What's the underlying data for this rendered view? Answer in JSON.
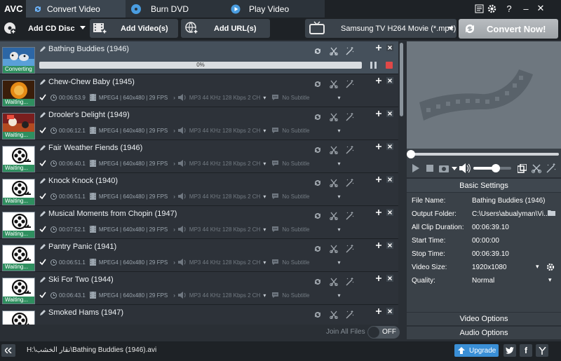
{
  "app": {
    "logo": "AVC"
  },
  "tabs": [
    {
      "label": "Convert Video",
      "active": true
    },
    {
      "label": "Burn DVD",
      "active": false
    },
    {
      "label": "Play Video",
      "active": false
    }
  ],
  "window_controls": {
    "help": "?",
    "minimize": "–",
    "close": "✕"
  },
  "toolbar": {
    "add_cd": "Add CD Disc",
    "add_video": "Add Video(s)",
    "add_url": "Add URL(s)",
    "profile": "Samsung TV H264 Movie (*.mp4)",
    "convert": "Convert Now!"
  },
  "files": [
    {
      "title": "Bathing Buddies (1946)",
      "status": "Converting",
      "thumb": "bath",
      "progress_pct": 0,
      "progress_label": "0%"
    },
    {
      "title": "Chew-Chew Baby (1945)",
      "status": "Waiting...",
      "thumb": "chew",
      "duration": "00:06:53.9",
      "video": "MPEG4 | 640x480 | 29 FPS",
      "audio": "MP3 44 KHz 128 Kbps 2 CH",
      "subtitle": "No Subtitle"
    },
    {
      "title": "Drooler's Delight (1949)",
      "status": "Waiting...",
      "thumb": "drool",
      "duration": "00:06:12.1",
      "video": "MPEG4 | 640x480 | 29 FPS",
      "audio": "MP3 44 KHz 128 Kbps 2 CH",
      "subtitle": "No Subtitle"
    },
    {
      "title": "Fair Weather Fiends (1946)",
      "status": "Waiting...",
      "thumb": "reel",
      "duration": "00:06:40.1",
      "video": "MPEG4 | 640x480 | 29 FPS",
      "audio": "MP3 44 KHz 128 Kbps 2 CH",
      "subtitle": "No Subtitle"
    },
    {
      "title": "Knock Knock (1940)",
      "status": "Waiting...",
      "thumb": "reel",
      "duration": "00:06:51.1",
      "video": "MPEG4 | 640x480 | 29 FPS",
      "audio": "MP3 44 KHz 128 Kbps 2 CH",
      "subtitle": "No Subtitle"
    },
    {
      "title": "Musical Moments from Chopin (1947)",
      "status": "Waiting...",
      "thumb": "reel",
      "duration": "00:07:52.1",
      "video": "MPEG4 | 640x480 | 29 FPS",
      "audio": "MP3 44 KHz 128 Kbps 2 CH",
      "subtitle": "No Subtitle"
    },
    {
      "title": "Pantry Panic (1941)",
      "status": "Waiting...",
      "thumb": "reel",
      "duration": "00:06:51.1",
      "video": "MPEG4 | 640x480 | 29 FPS",
      "audio": "MP3 44 KHz 128 Kbps 2 CH",
      "subtitle": "No Subtitle"
    },
    {
      "title": "Ski For Two (1944)",
      "status": "Waiting...",
      "thumb": "reel",
      "duration": "00:06:43.1",
      "video": "MPEG4 | 640x480 | 29 FPS",
      "audio": "MP3 44 KHz 128 Kbps 2 CH",
      "subtitle": "No Subtitle"
    },
    {
      "title": "Smoked Hams (1947)",
      "status": "Waiting...",
      "thumb": "reel",
      "duration": "",
      "video": "",
      "audio": "",
      "subtitle": ""
    }
  ],
  "join": {
    "label": "Join All Files",
    "toggle": "OFF"
  },
  "settings": {
    "header": "Basic Settings",
    "rows": [
      {
        "key": "File Name:",
        "value": "Bathing Buddies (1946)"
      },
      {
        "key": "Output Folder:",
        "value": "C:\\Users\\abualyman\\Vi..."
      },
      {
        "key": "All Clip Duration:",
        "value": "00:06:39.10"
      },
      {
        "key": "Start Time:",
        "value": "00:00:00"
      },
      {
        "key": "Stop Time:",
        "value": "00:06:39.10"
      },
      {
        "key": "Video Size:",
        "value": "1920x1080"
      },
      {
        "key": "Quality:",
        "value": "Normal"
      }
    ],
    "video_options": "Video Options",
    "audio_options": "Audio Options"
  },
  "player": {
    "volume_fraction": 0.6,
    "position_fraction": 0.0
  },
  "statusbar": {
    "path": "H:\\نقار الخشب\\Bathing Buddies (1946).avi",
    "upgrade": "Upgrade"
  },
  "colors": {
    "accent": "#2f8f5f",
    "selected_row": "#45505b",
    "upgrade": "#3a8fd6"
  }
}
